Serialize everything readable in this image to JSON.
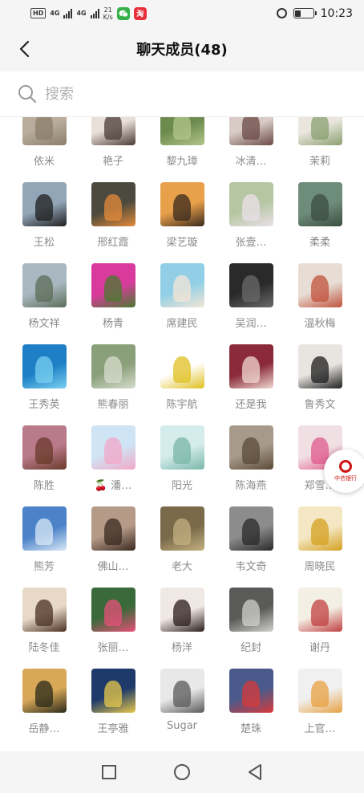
{
  "status_bar": {
    "network_badge": "HD",
    "network_label_1": "4G",
    "network_label_2": "4G",
    "speed_value": "21",
    "speed_unit": "K/s",
    "app_icon_taobao": "淘",
    "time": "10:23",
    "icons": [
      "hd-icon",
      "signal-icon",
      "wechat-icon",
      "taobao-icon",
      "alarm-icon",
      "battery-icon"
    ]
  },
  "header": {
    "title": "聊天成员(48)",
    "back_icon": "chevron-left-icon"
  },
  "search": {
    "placeholder": "搜索",
    "icon": "search-icon"
  },
  "members": [
    {
      "name": "依米",
      "avatar_bg": "#b8ad9c",
      "avatar_fg": "#8b7f6b"
    },
    {
      "name": "艳子",
      "avatar_bg": "#e8dfd8",
      "avatar_fg": "#4a3b35"
    },
    {
      "name": "黎九璋",
      "avatar_bg": "#6d8b4f",
      "avatar_fg": "#b2c58a"
    },
    {
      "name": "冰清…",
      "avatar_bg": "#d8cbc6",
      "avatar_fg": "#6b4a45"
    },
    {
      "name": "茉莉",
      "avatar_bg": "#eae6de",
      "avatar_fg": "#8aa070"
    },
    {
      "name": "王松",
      "avatar_bg": "#93a6b8",
      "avatar_fg": "#1f1f1f"
    },
    {
      "name": "邢红霞",
      "avatar_bg": "#4c4a3e",
      "avatar_fg": "#e48b3a"
    },
    {
      "name": "梁艺璇",
      "avatar_bg": "#e8a04a",
      "avatar_fg": "#3a2a1e"
    },
    {
      "name": "张壹…",
      "avatar_bg": "#b6c6a2",
      "avatar_fg": "#e9e0e8"
    },
    {
      "name": "柔柔",
      "avatar_bg": "#6e8c7a",
      "avatar_fg": "#3c4e40"
    },
    {
      "name": "杨文祥",
      "avatar_bg": "#a9b7c0",
      "avatar_fg": "#5c6e5a"
    },
    {
      "name": "杨青",
      "avatar_bg": "#d93b9c",
      "avatar_fg": "#4a7a30"
    },
    {
      "name": "席建民",
      "avatar_bg": "#92cfe6",
      "avatar_fg": "#f4e6d6"
    },
    {
      "name": "吴润…",
      "avatar_bg": "#2a2a2a",
      "avatar_fg": "#6a6a6a"
    },
    {
      "name": "温秋梅",
      "avatar_bg": "#e7ddd4",
      "avatar_fg": "#c0523c"
    },
    {
      "name": "王秀英",
      "avatar_bg": "#1e7fc6",
      "avatar_fg": "#7ad0f0"
    },
    {
      "name": "熊春丽",
      "avatar_bg": "#8aa07a",
      "avatar_fg": "#d6dccd"
    },
    {
      "name": "陈宇航",
      "avatar_bg": "#ffffff",
      "avatar_fg": "#e0c020"
    },
    {
      "name": "还是我",
      "avatar_bg": "#8a2a3a",
      "avatar_fg": "#f0d8d0"
    },
    {
      "name": "鲁秀文",
      "avatar_bg": "#e8e4e0",
      "avatar_fg": "#1e1e1e"
    },
    {
      "name": "陈胜",
      "avatar_bg": "#b97a8a",
      "avatar_fg": "#6a3a2a"
    },
    {
      "name": "🍒 潘…",
      "avatar_bg": "#cfe4f4",
      "avatar_fg": "#f2a8c8"
    },
    {
      "name": "阳光",
      "avatar_bg": "#d4ecec",
      "avatar_fg": "#7ab6a8"
    },
    {
      "name": "陈海燕",
      "avatar_bg": "#a89a8a",
      "avatar_fg": "#5a4a3a"
    },
    {
      "name": "郑雪…",
      "avatar_bg": "#f0e0e4",
      "avatar_fg": "#e05a8a"
    },
    {
      "name": "熊芳",
      "avatar_bg": "#4c82c8",
      "avatar_fg": "#d8e8f6"
    },
    {
      "name": "佛山…",
      "avatar_bg": "#b69a88",
      "avatar_fg": "#3a2a20"
    },
    {
      "name": "老大",
      "avatar_bg": "#7a6a4a",
      "avatar_fg": "#c4b080"
    },
    {
      "name": "韦文奇",
      "avatar_bg": "#8c8c8c",
      "avatar_fg": "#2a2a2a"
    },
    {
      "name": "周晓民",
      "avatar_bg": "#f4e8c4",
      "avatar_fg": "#d4a020"
    },
    {
      "name": "陆冬佳",
      "avatar_bg": "#e8d8c8",
      "avatar_fg": "#4a3020"
    },
    {
      "name": "张丽…",
      "avatar_bg": "#3a6a3a",
      "avatar_fg": "#e8507a"
    },
    {
      "name": "杨洋",
      "avatar_bg": "#f0e8e4",
      "avatar_fg": "#2a1e1a"
    },
    {
      "name": "纪封",
      "avatar_bg": "#5a5a58",
      "avatar_fg": "#d0d0cc"
    },
    {
      "name": "谢丹",
      "avatar_bg": "#f4efe4",
      "avatar_fg": "#c04040"
    },
    {
      "name": "岳静…",
      "avatar_bg": "#d8a858",
      "avatar_fg": "#2a2a1a"
    },
    {
      "name": "王亭雅",
      "avatar_bg": "#1e3a6a",
      "avatar_fg": "#e8c84a"
    },
    {
      "name": "Sugar",
      "avatar_bg": "#e8e8e8",
      "avatar_fg": "#5a5a5a"
    },
    {
      "name": "楚珠",
      "avatar_bg": "#4a5a8a",
      "avatar_fg": "#d83a3a"
    },
    {
      "name": "上官…",
      "avatar_bg": "#f0f0f0",
      "avatar_fg": "#e8a040"
    }
  ],
  "float_badge": {
    "text": "中信银行",
    "icon": "bank-logo-icon"
  },
  "nav_bar": {
    "icons": [
      "recent-apps-icon",
      "home-icon",
      "back-icon"
    ]
  }
}
